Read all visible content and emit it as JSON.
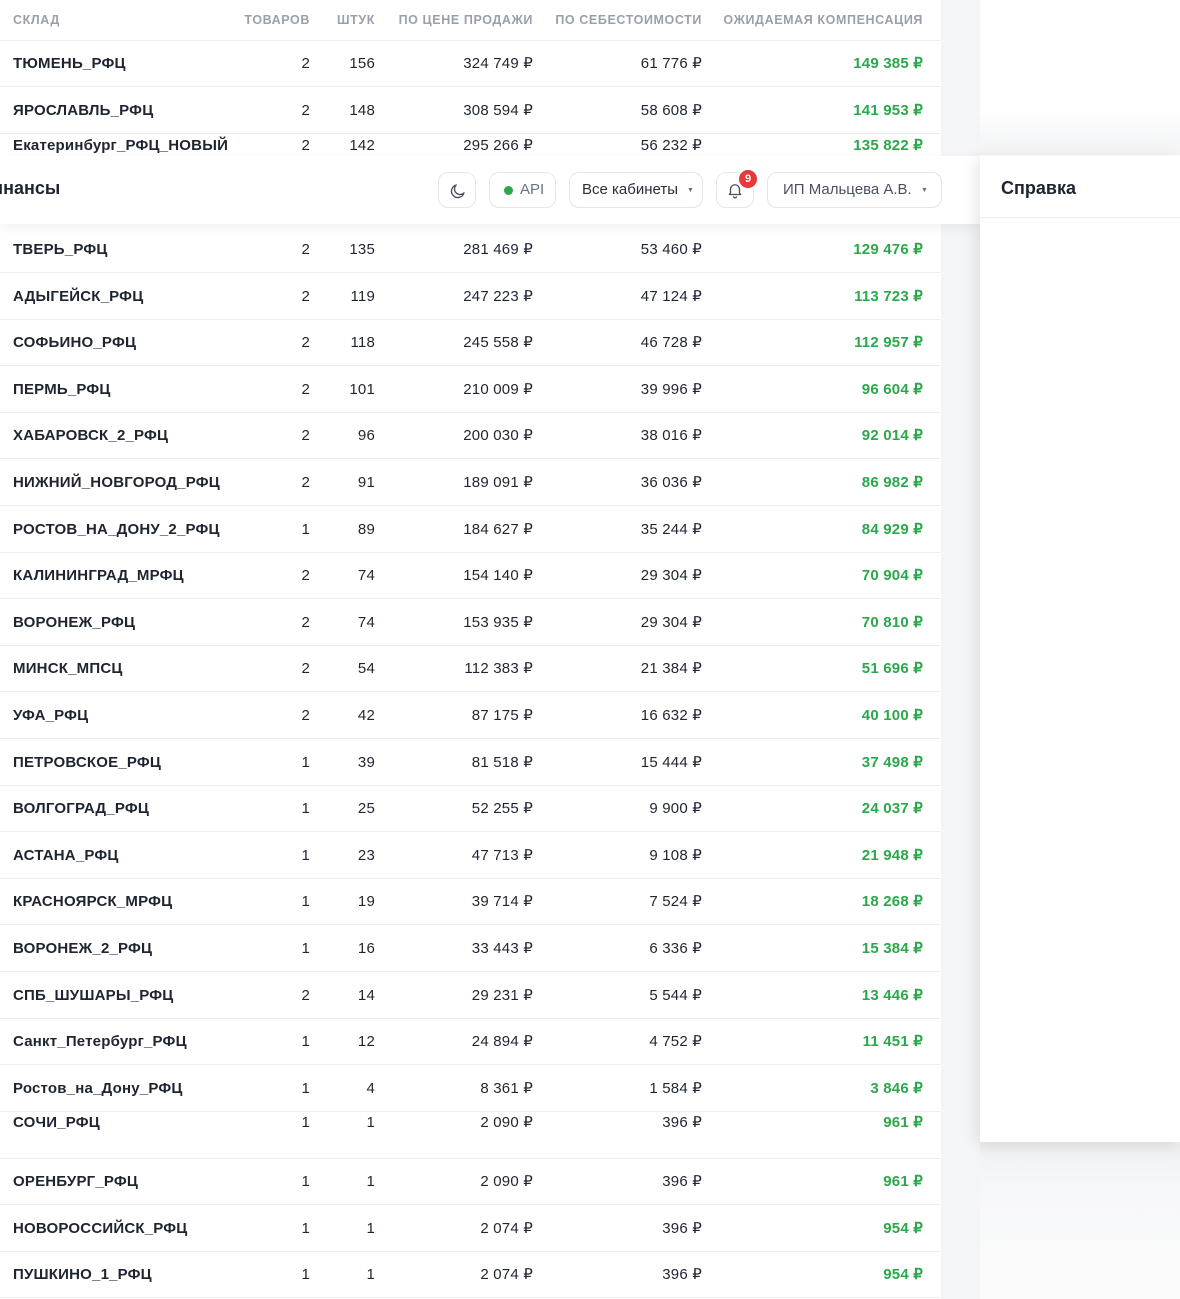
{
  "header": {
    "page_title": "инансы",
    "api_label": "API",
    "cabinets_label": "Все кабинеты",
    "notifications_count": "9",
    "user_label": "ИП Мальцева А.В.",
    "accent_green": "#2aa84a",
    "badge_red": "#e5393a"
  },
  "help": {
    "title": "Справка"
  },
  "table": {
    "columns": [
      "СКЛАД",
      "ТОВАРОВ",
      "ШТУК",
      "ПО ЦЕНЕ ПРОДАЖИ",
      "ПО СЕБЕСТОИМОСТИ",
      "ОЖИДАЕМАЯ КОМПЕНСАЦИЯ"
    ],
    "rows_top": [
      [
        "ТЮМЕНЬ_РФЦ",
        "2",
        "156",
        "324 749 ₽",
        "61 776 ₽",
        "149 385 ₽"
      ],
      [
        "ЯРОСЛАВЛЬ_РФЦ",
        "2",
        "148",
        "308 594 ₽",
        "58 608 ₽",
        "141 953 ₽"
      ],
      [
        "Екатеринбург_РФЦ_НОВЫЙ",
        "2",
        "142",
        "295 266 ₽",
        "56 232 ₽",
        "135 822 ₽"
      ]
    ],
    "rows_main": [
      [
        "ТВЕРЬ_РФЦ",
        "2",
        "135",
        "281 469 ₽",
        "53 460 ₽",
        "129 476 ₽"
      ],
      [
        "АДЫГЕЙСК_РФЦ",
        "2",
        "119",
        "247 223 ₽",
        "47 124 ₽",
        "113 723 ₽"
      ],
      [
        "СОФЬИНО_РФЦ",
        "2",
        "118",
        "245 558 ₽",
        "46 728 ₽",
        "112 957 ₽"
      ],
      [
        "ПЕРМЬ_РФЦ",
        "2",
        "101",
        "210 009 ₽",
        "39 996 ₽",
        "96 604 ₽"
      ],
      [
        "ХАБАРОВСК_2_РФЦ",
        "2",
        "96",
        "200 030 ₽",
        "38 016 ₽",
        "92 014 ₽"
      ],
      [
        "НИЖНИЙ_НОВГОРОД_РФЦ",
        "2",
        "91",
        "189 091 ₽",
        "36 036 ₽",
        "86 982 ₽"
      ],
      [
        "РОСТОВ_НА_ДОНУ_2_РФЦ",
        "1",
        "89",
        "184 627 ₽",
        "35 244 ₽",
        "84 929 ₽"
      ],
      [
        "КАЛИНИНГРАД_МРФЦ",
        "2",
        "74",
        "154 140 ₽",
        "29 304 ₽",
        "70 904 ₽"
      ],
      [
        "ВОРОНЕЖ_РФЦ",
        "2",
        "74",
        "153 935 ₽",
        "29 304 ₽",
        "70 810 ₽"
      ],
      [
        "МИНСК_МПСЦ",
        "2",
        "54",
        "112 383 ₽",
        "21 384 ₽",
        "51 696 ₽"
      ],
      [
        "УФА_РФЦ",
        "2",
        "42",
        "87 175 ₽",
        "16 632 ₽",
        "40 100 ₽"
      ],
      [
        "ПЕТРОВСКОЕ_РФЦ",
        "1",
        "39",
        "81 518 ₽",
        "15 444 ₽",
        "37 498 ₽"
      ],
      [
        "ВОЛГОГРАД_РФЦ",
        "1",
        "25",
        "52 255 ₽",
        "9 900 ₽",
        "24 037 ₽"
      ],
      [
        "АСТАНА_РФЦ",
        "1",
        "23",
        "47 713 ₽",
        "9 108 ₽",
        "21 948 ₽"
      ],
      [
        "КРАСНОЯРСК_МРФЦ",
        "1",
        "19",
        "39 714 ₽",
        "7 524 ₽",
        "18 268 ₽"
      ],
      [
        "ВОРОНЕЖ_2_РФЦ",
        "1",
        "16",
        "33 443 ₽",
        "6 336 ₽",
        "15 384 ₽"
      ],
      [
        "СПБ_ШУШАРЫ_РФЦ",
        "2",
        "14",
        "29 231 ₽",
        "5 544 ₽",
        "13 446 ₽"
      ],
      [
        "Санкт_Петербург_РФЦ",
        "1",
        "12",
        "24 894 ₽",
        "4 752 ₽",
        "11 451 ₽"
      ],
      [
        "Ростов_на_Дону_РФЦ",
        "1",
        "4",
        "8 361 ₽",
        "1 584 ₽",
        "3 846 ₽"
      ],
      [
        "СОЧИ_РФЦ",
        "1",
        "1",
        "2 090 ₽",
        "396 ₽",
        "961 ₽"
      ]
    ],
    "rows_bottom": [
      [
        "ОРЕНБУРГ_РФЦ",
        "1",
        "1",
        "2 090 ₽",
        "396 ₽",
        "961 ₽"
      ],
      [
        "НОВОРОССИЙСК_РФЦ",
        "1",
        "1",
        "2 074 ₽",
        "396 ₽",
        "954 ₽"
      ],
      [
        "ПУШКИНО_1_РФЦ",
        "1",
        "1",
        "2 074 ₽",
        "396 ₽",
        "954 ₽"
      ]
    ]
  }
}
